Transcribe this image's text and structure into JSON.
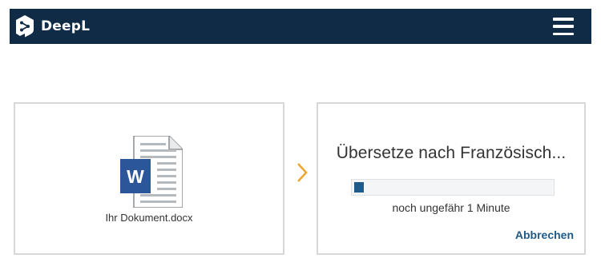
{
  "header": {
    "brand_name": "DeepL",
    "logo_icon": "deepl-logo-icon",
    "menu_icon": "hamburger-menu-icon",
    "background_color": "#0f2b46"
  },
  "document": {
    "file_icon": "word-document-icon",
    "file_name": "Ihr Dokument.docx"
  },
  "arrow_icon": "chevron-right-icon",
  "arrow_color": "#f0a531",
  "translation": {
    "status_text": "Übersetze nach Französisch...",
    "progress_fraction": 0.05,
    "eta_text": "noch ungefähr 1 Minute",
    "cancel_label": "Abbrechen",
    "accent_color": "#1e5a8a"
  }
}
